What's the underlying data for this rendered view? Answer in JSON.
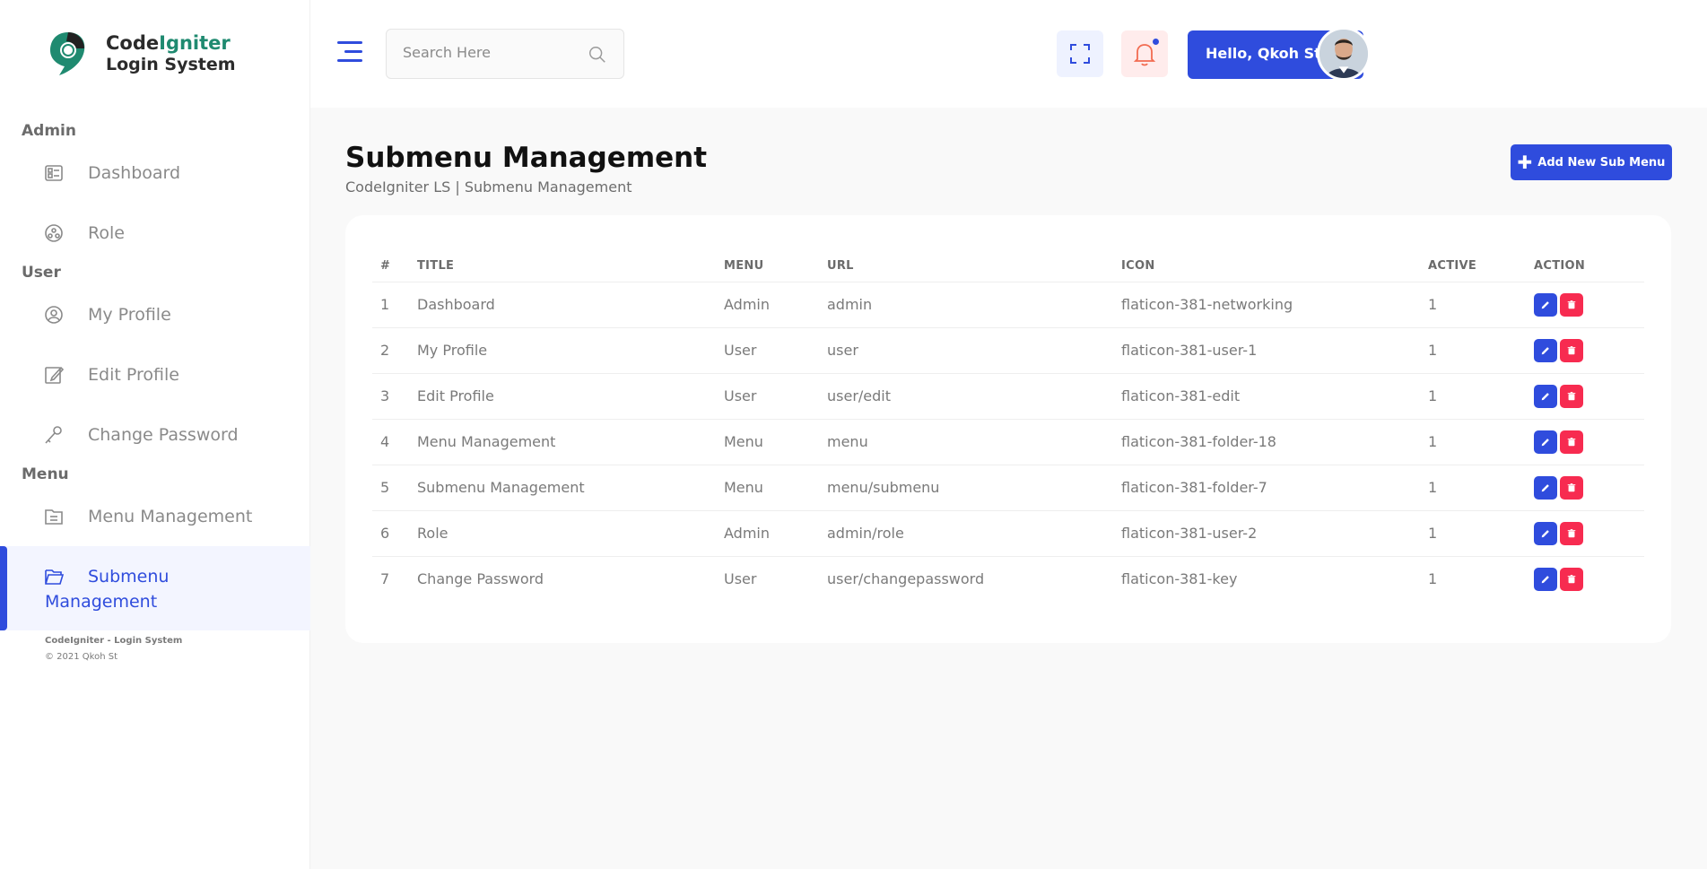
{
  "brand": {
    "line1_a": "Code",
    "line1_b": "Igniter",
    "line2": "Login System"
  },
  "sidebar": {
    "sections": [
      {
        "heading": "Admin"
      },
      {
        "heading": "User"
      },
      {
        "heading": "Menu"
      }
    ],
    "items": [
      {
        "label": "Dashboard",
        "icon": "dashboard-icon"
      },
      {
        "label": "Role",
        "icon": "networking-icon"
      },
      {
        "label": "My Profile",
        "icon": "user-icon"
      },
      {
        "label": "Edit Profile",
        "icon": "edit-icon"
      },
      {
        "label": "Change Password",
        "icon": "key-icon"
      },
      {
        "label": "Menu Management",
        "icon": "folder-icon"
      },
      {
        "label": "Submenu Management",
        "icon": "open-folder-icon",
        "active": true
      }
    ],
    "footer": {
      "line1": "CodeIgniter - Login System",
      "line2": "© 2021 Qkoh St"
    }
  },
  "header": {
    "search_placeholder": "Search Here",
    "user_greeting": "Hello, Qkoh St"
  },
  "page": {
    "title": "Submenu Management",
    "subtitle": "CodeIgniter LS | Submenu Management",
    "add_button": "Add New Sub Menu"
  },
  "table": {
    "headers": [
      "#",
      "TITLE",
      "MENU",
      "URL",
      "ICON",
      "ACTIVE",
      "ACTION"
    ],
    "rows": [
      [
        "1",
        "Dashboard",
        "Admin",
        "admin",
        "flaticon-381-networking",
        "1"
      ],
      [
        "2",
        "My Profile",
        "User",
        "user",
        "flaticon-381-user-1",
        "1"
      ],
      [
        "3",
        "Edit Profile",
        "User",
        "user/edit",
        "flaticon-381-edit",
        "1"
      ],
      [
        "4",
        "Menu Management",
        "Menu",
        "menu",
        "flaticon-381-folder-18",
        "1"
      ],
      [
        "5",
        "Submenu Management",
        "Menu",
        "menu/submenu",
        "flaticon-381-folder-7",
        "1"
      ],
      [
        "6",
        "Role",
        "Admin",
        "admin/role",
        "flaticon-381-user-2",
        "1"
      ],
      [
        "7",
        "Change Password",
        "User",
        "user/changepassword",
        "flaticon-381-key",
        "1"
      ]
    ]
  },
  "colors": {
    "primary": "#2f4cdd",
    "danger": "#f72b50",
    "brand_accent": "#1f8a70"
  }
}
